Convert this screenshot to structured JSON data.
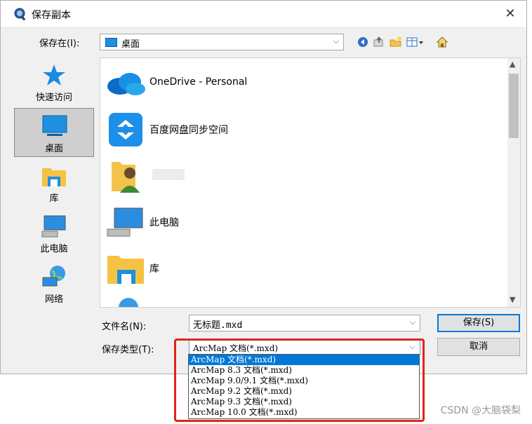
{
  "window": {
    "title": "保存副本",
    "close_glyph": "✕"
  },
  "lookin": {
    "label": "保存在(I):",
    "value": "桌面",
    "arrow": "⌵"
  },
  "toolbar": {
    "icons": [
      "back-icon",
      "up-folder-icon",
      "new-folder-icon",
      "view-menu-icon",
      "home-icon"
    ]
  },
  "places": [
    {
      "label": "快速访问",
      "icon": "star-icon"
    },
    {
      "label": "桌面",
      "icon": "desktop-icon",
      "selected": true
    },
    {
      "label": "库",
      "icon": "library-folder-icon"
    },
    {
      "label": "此电脑",
      "icon": "computer-icon"
    },
    {
      "label": "网络",
      "icon": "network-icon"
    }
  ],
  "files": [
    {
      "name": "OneDrive - Personal",
      "icon": "onedrive-cloud-icon"
    },
    {
      "name": "百度网盘同步空间",
      "icon": "baidu-netdisk-icon"
    },
    {
      "name": "",
      "icon": "user-folder-icon"
    },
    {
      "name": "此电脑",
      "icon": "computer-icon"
    },
    {
      "name": "库",
      "icon": "library-folder-icon"
    }
  ],
  "filename": {
    "label": "文件名(N):",
    "value": "无标题.mxd"
  },
  "filetype": {
    "label": "保存类型(T):",
    "value": "ArcMap 文档(*.mxd)",
    "options": [
      "ArcMap 文档(*.mxd)",
      "ArcMap 8.3 文档(*.mxd)",
      "ArcMap 9.0/9.1 文档(*.mxd)",
      "ArcMap 9.2 文档(*.mxd)",
      "ArcMap 9.3 文档(*.mxd)",
      "ArcMap 10.0 文档(*.mxd)"
    ],
    "selected_index": 0
  },
  "buttons": {
    "save": "保存(S)",
    "cancel": "取消"
  },
  "watermark": "CSDN @大脑袋梨",
  "colors": {
    "accent": "#0078d7",
    "highlight_box": "#e2231a"
  }
}
